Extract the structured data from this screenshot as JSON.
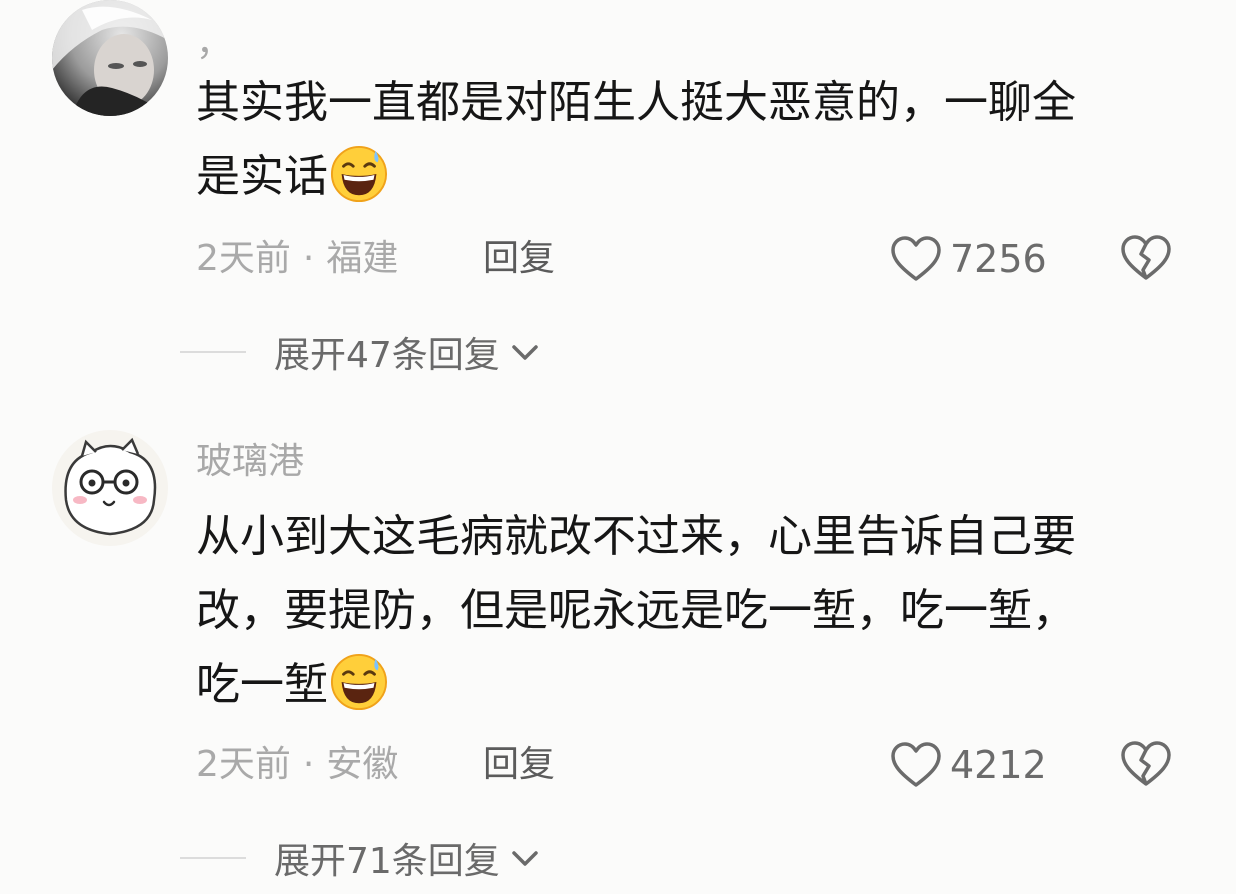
{
  "comments": [
    {
      "username": "，",
      "lines": [
        "其实我一直都是对陌生人挺大恶意的，一聊全",
        "是实话"
      ],
      "emoji": "grinning-sweat-emoji",
      "time": "2天前",
      "location": "福建",
      "reply_label": "回复",
      "likes": "7256",
      "expand_label": "展开47条回复"
    },
    {
      "username": "玻璃港",
      "lines": [
        "从小到大这毛病就改不过来，心里告诉自己要",
        "改，要提防，但是呢永远是吃一堑，吃一堑，",
        "吃一堑"
      ],
      "emoji": "grinning-sweat-emoji",
      "time": "2天前",
      "location": "安徽",
      "reply_label": "回复",
      "likes": "4212",
      "expand_label": "展开71条回复"
    }
  ],
  "meta_separator": "·",
  "colors": {
    "background": "#fbfbfa",
    "text": "#161616",
    "meta": "#a9a9a9",
    "icon": "#6b6b6b"
  }
}
